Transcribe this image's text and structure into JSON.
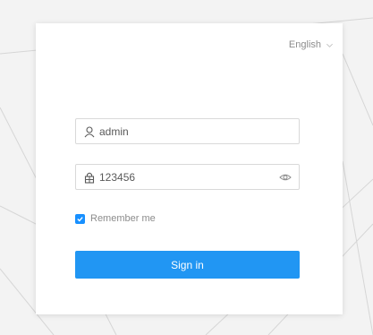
{
  "language_selector": {
    "label": "English",
    "icon": "chevron-down-icon"
  },
  "username_field": {
    "value": "admin",
    "icon": "user-icon"
  },
  "password_field": {
    "value": "123456",
    "icon": "lock-icon",
    "toggle_icon": "eye-icon"
  },
  "remember_me": {
    "label": "Remember me",
    "checked": true
  },
  "sign_in_button": {
    "label": "Sign in"
  },
  "colors": {
    "primary": "#2196f3",
    "background": "#f3f3f3",
    "card": "#ffffff"
  }
}
